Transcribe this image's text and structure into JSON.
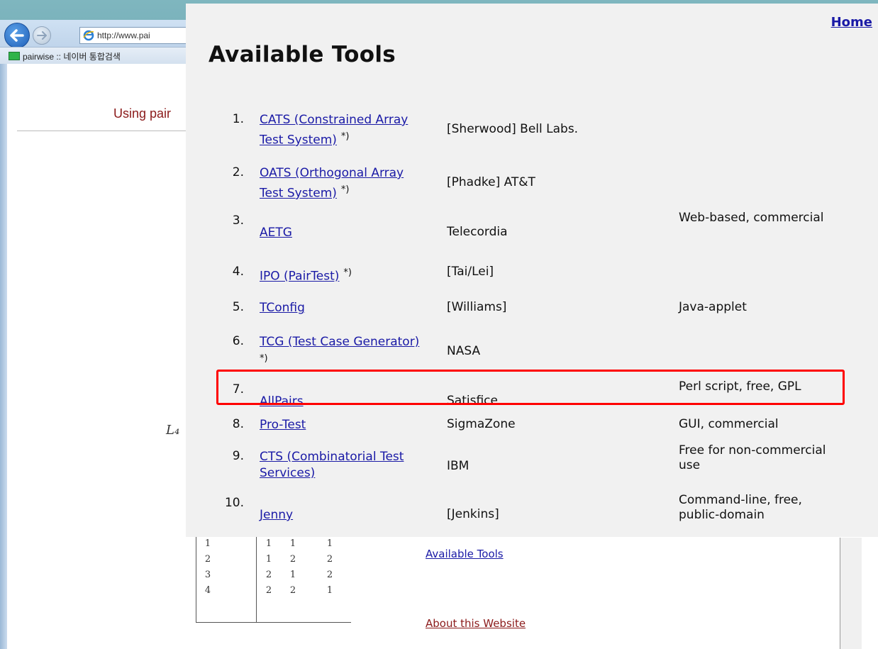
{
  "browser": {
    "address_text": "http://www.pai",
    "favorite_label": "pairwise :: 네이버 통합검색"
  },
  "background_page": {
    "header_text": "Using pair",
    "l4_label": "L₄",
    "l4_rows": [
      [
        "1",
        "1",
        "1",
        "1"
      ],
      [
        "2",
        "1",
        "2",
        "2"
      ],
      [
        "3",
        "2",
        "1",
        "2"
      ],
      [
        "4",
        "2",
        "2",
        "1"
      ]
    ],
    "link_available_tools": "Available Tools",
    "link_about": "About this Website"
  },
  "panel": {
    "home_label": "Home",
    "title": "Available Tools",
    "tools": [
      {
        "num": "1.",
        "name_lines": [
          "CATS (Constrained Array",
          "Test System)"
        ],
        "star": "*)",
        "org": "[Sherwood] Bell Labs.",
        "note": ""
      },
      {
        "num": "2.",
        "name_lines": [
          "OATS (Orthogonal Array",
          "Test System)"
        ],
        "star": "*)",
        "org": "[Phadke] AT&T",
        "note": ""
      },
      {
        "num": "3.",
        "name_lines": [
          "AETG"
        ],
        "star": "",
        "org": "Telecordia",
        "note": "Web-based, commercial"
      },
      {
        "num": "4.",
        "name_lines": [
          "IPO (PairTest)"
        ],
        "star": "*)",
        "org": "[Tai/Lei]",
        "note": ""
      },
      {
        "num": "5.",
        "name_lines": [
          "TConfig"
        ],
        "star": "",
        "org": "[Williams]",
        "note": "Java-applet"
      },
      {
        "num": "6.",
        "name_lines": [
          "TCG (Test Case Generator)"
        ],
        "star": "*)",
        "org": "NASA",
        "note": ""
      },
      {
        "num": "7.",
        "name_lines": [
          "AllPairs"
        ],
        "star": "",
        "org": "Satisfice",
        "note": "Perl script, free, GPL"
      },
      {
        "num": "8.",
        "name_lines": [
          "Pro-Test"
        ],
        "star": "",
        "org": "SigmaZone",
        "note": "GUI, commercial"
      },
      {
        "num": "9.",
        "name_lines": [
          "CTS (Combinatorial Test",
          "Services)"
        ],
        "star": "",
        "org": "IBM",
        "note": "Free for non-commercial use"
      },
      {
        "num": "10.",
        "name_lines": [
          "Jenny"
        ],
        "star": "",
        "org": "[Jenkins]",
        "note": "Command-line, free, public-domain"
      }
    ],
    "highlight_color": "#ff0000",
    "link_color": "#1a1aa6"
  }
}
